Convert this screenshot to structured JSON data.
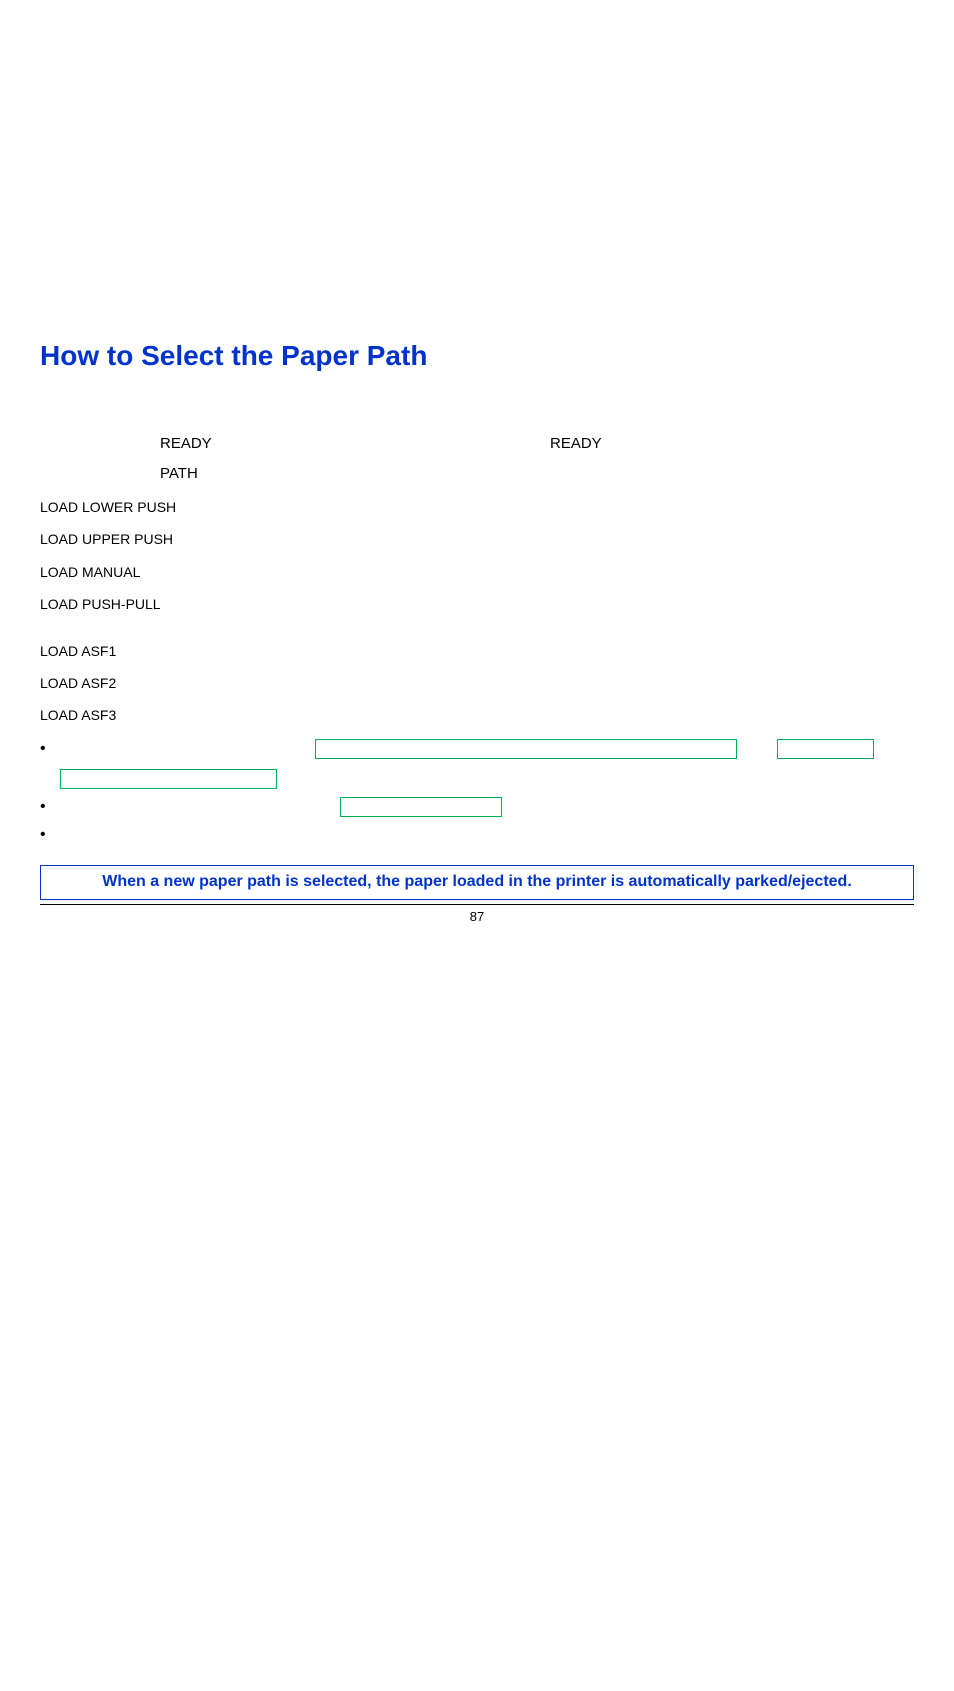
{
  "title": "How to Select the Paper Path",
  "ready_line": {
    "left_pad": "",
    "ready1": "READY",
    "ready2": "READY"
  },
  "path_line": {
    "left_pad": "",
    "path": "PATH"
  },
  "load_items": [
    "LOAD LOWER PUSH",
    "LOAD UPPER PUSH",
    "LOAD MANUAL",
    "LOAD PUSH-PULL"
  ],
  "load_items_asf": [
    "LOAD ASF1",
    "LOAD ASF2",
    "LOAD ASF3"
  ],
  "note_box": "When a new paper path is selected, the paper loaded in the printer is automatically parked/ejected.",
  "page_number": "87"
}
